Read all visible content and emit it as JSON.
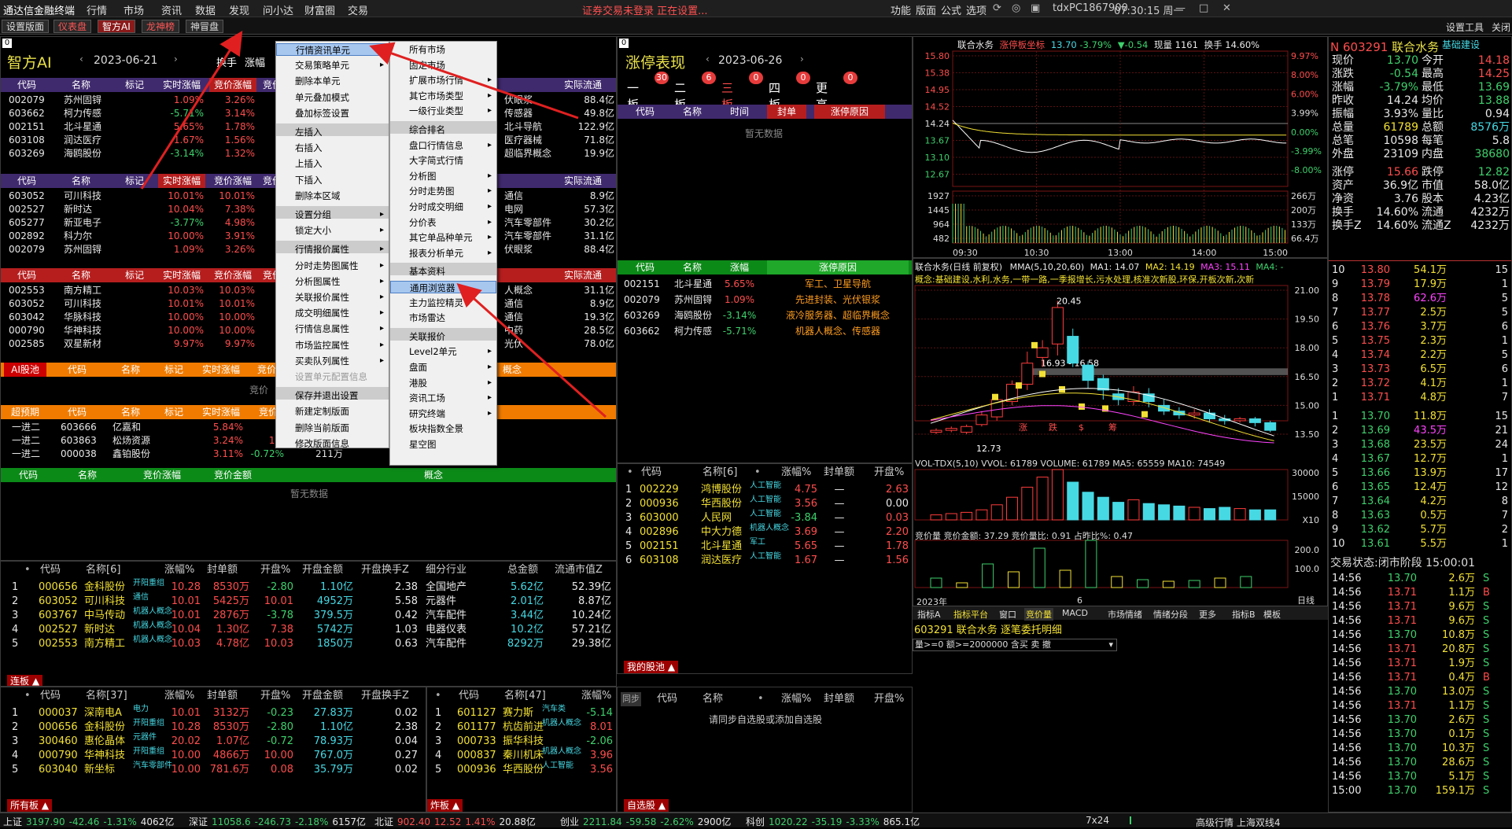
{
  "menubar": {
    "app": "通达信金融终端",
    "items": [
      "行情",
      "市场",
      "资讯",
      "数据",
      "发现",
      "问小达",
      "财富圈",
      "交易"
    ],
    "status": "证券交易未登录 正在设置...",
    "right": [
      "功能",
      "版面",
      "公式",
      "选项"
    ],
    "user": "tdxPC1867900",
    "time": "07:30:15 周一"
  },
  "tabs": [
    "设置版面",
    "仪表盘",
    "智方AI",
    "龙神榜",
    "神冒盘"
  ],
  "tabs_right": [
    "设置工具",
    "关闭"
  ],
  "zhifang": {
    "title": "智方AI",
    "date": "2023-06-21",
    "huanshou": "换手",
    "zhangfu": "涨幅"
  },
  "grp1": {
    "headers": [
      "代码",
      "名称",
      "标记",
      "实时涨幅",
      "竞价涨幅",
      "竞价",
      "实际流通"
    ],
    "rows": [
      [
        "002079",
        "苏州固锝",
        "",
        "1.09%",
        "3.26%",
        "",
        "88.4亿"
      ],
      [
        "603662",
        "柯力传感",
        "",
        "-5.71%",
        "3.14%",
        "",
        "49.8亿"
      ],
      [
        "002151",
        "北斗星通",
        "",
        "5.65%",
        "1.78%",
        "",
        "122.9亿"
      ],
      [
        "603108",
        "润达医疗",
        "",
        "1.67%",
        "1.56%",
        "",
        "71.8亿"
      ],
      [
        "603269",
        "海鸥股份",
        "",
        "-3.14%",
        "1.32%",
        "",
        "19.9亿"
      ]
    ]
  },
  "grp2": {
    "rows": [
      [
        "603052",
        "可川科技",
        "",
        "10.01%",
        "10.01%",
        "",
        "8.9亿"
      ],
      [
        "002527",
        "新时达",
        "",
        "10.04%",
        "7.38%",
        "",
        "57.3亿"
      ],
      [
        "605277",
        "新亚电子",
        "",
        "-3.77%",
        "4.98%",
        "",
        "30.2亿"
      ],
      [
        "002892",
        "科力尔",
        "",
        "10.00%",
        "3.91%",
        "",
        "31.1亿"
      ],
      [
        "002079",
        "苏州固锝",
        "",
        "1.09%",
        "3.26%",
        "",
        "88.4亿"
      ]
    ]
  },
  "grp3": {
    "rows": [
      [
        "002553",
        "南方精工",
        "",
        "10.03%",
        "10.03%",
        "",
        "31.1亿"
      ],
      [
        "603052",
        "可川科技",
        "",
        "10.01%",
        "10.01%",
        "",
        "8.9亿"
      ],
      [
        "603042",
        "华脉科技",
        "",
        "10.00%",
        "10.00%",
        "",
        "19.3亿"
      ],
      [
        "000790",
        "华神科技",
        "",
        "10.00%",
        "10.00%",
        "",
        "28.5亿"
      ],
      [
        "002585",
        "双星新材",
        "",
        "9.97%",
        "9.97%",
        "",
        "78.0亿"
      ]
    ]
  },
  "grp_concept_texts": [
    "伏眼浆",
    "传感器",
    "北斗导航",
    "医疗器械",
    "超临界概念",
    "通信",
    "电网",
    "汽车零部件",
    "汽车零部件",
    "伏眼浆",
    "人概念",
    "通信",
    "通信",
    "中药",
    "光伏"
  ],
  "ai_bar": {
    "headers": [
      "AI股池",
      "代码",
      "名称",
      "标记",
      "实时涨幅",
      "竞价涨幅",
      "竞价",
      "概念"
    ],
    "empty": "竞价"
  },
  "chaoyuqi": {
    "headers": [
      "超预期",
      "代码",
      "名称",
      "标记",
      "实时涨幅",
      "竞价"
    ],
    "rows": [
      [
        "一进二",
        "603666",
        "亿嘉和",
        "",
        "5.84%",
        ""
      ],
      [
        "一进二",
        "603863",
        "松炀资源",
        "",
        "3.24%",
        "1.6"
      ],
      [
        "一进二",
        "000038",
        "鑫铂股份",
        "",
        "3.11%",
        "-0.72%",
        "211万"
      ]
    ]
  },
  "green_bar": {
    "headers": [
      "代码",
      "名称",
      "竞价涨幅",
      "竞价金额",
      "概念"
    ],
    "empty": "暂无数据"
  },
  "ctx1": {
    "items": [
      "行情资讯单元",
      "交易策略单元",
      "删除本单元",
      "单元叠加模式",
      "叠加标签设置",
      "左插入",
      "右插入",
      "上插入",
      "下插入",
      "删除本区域",
      "设置分组",
      "锁定大小",
      "行情报价属性",
      "分时走势图属性",
      "分析图属性",
      "关联报价属性",
      "成交明细属性",
      "行情信息属性",
      "市场监控属性",
      "买卖队列属性",
      "设置单元配置信息",
      "保存并退出设置",
      "新建定制版面",
      "删除当前版面",
      "修改版面信息"
    ]
  },
  "ctx2": {
    "items": [
      "所有市场",
      "固定市场",
      "扩展市场行情",
      "其它市场类型",
      "一级行业类型",
      "综合排名",
      "盘口行情信息",
      "大字简式行情",
      "分析图",
      "分时走势图",
      "分时成交明细",
      "分价表",
      "其它单品种单元",
      "报表分析单元",
      "基本资料",
      "通用浏览器",
      "主力监控精灵",
      "市场雷达",
      "关联报价",
      "Level2单元",
      "盘面",
      "港股",
      "资讯工场",
      "研究终端",
      "板块指数全景",
      "星空图"
    ]
  },
  "zt": {
    "title": "涨停表现",
    "date": "2023-06-26",
    "boards": [
      {
        "l": "一板",
        "n": "30"
      },
      {
        "l": "二板",
        "n": "6"
      },
      {
        "l": "三板",
        "n": "0"
      },
      {
        "l": "四板",
        "n": "0"
      },
      {
        "l": "更高",
        "n": "0"
      }
    ],
    "headers": [
      "代码",
      "名称",
      "时间",
      "封单",
      "涨停原因"
    ],
    "empty": "暂无数据"
  },
  "zt2": {
    "headers": [
      "代码",
      "名称",
      "涨幅",
      "涨停原因"
    ],
    "rows": [
      [
        "002151",
        "北斗星通",
        "5.65%",
        "军工、卫星导航"
      ],
      [
        "002079",
        "苏州固锝",
        "1.09%",
        "先进封装、光伏银浆"
      ],
      [
        "603269",
        "海鸥股份",
        "-3.14%",
        "液冷服务器、超临界概念"
      ],
      [
        "603662",
        "柯力传感",
        "-5.71%",
        "机器人概念、传感器"
      ]
    ]
  },
  "mid_list": {
    "headers": [
      "代码",
      "名称[6]",
      "涨幅%",
      "封单额",
      "开盘%"
    ],
    "rows": [
      [
        "1",
        "002229",
        "鸿博股份",
        "人工智能",
        "4.75",
        "—",
        "2.63"
      ],
      [
        "2",
        "000936",
        "华西股份",
        "人工智能",
        "3.56",
        "—",
        "0.00"
      ],
      [
        "3",
        "603000",
        "人民网",
        "人工智能",
        "-3.84",
        "—",
        "0.03"
      ],
      [
        "4",
        "002896",
        "中大力德",
        "机器人概念",
        "3.69",
        "—",
        "2.20"
      ],
      [
        "5",
        "002151",
        "北斗星通",
        "军工",
        "5.65",
        "—",
        "1.78"
      ],
      [
        "6",
        "603108",
        "润达医疗",
        "人工智能",
        "1.67",
        "—",
        "1.56"
      ]
    ]
  },
  "zixuan": {
    "tab": "我的股池",
    "headers": [
      "同步",
      "代码",
      "名称",
      "涨幅%",
      "封单额",
      "开盘%"
    ],
    "empty": "请同步自选股或添加自选股",
    "bottom": "自选股"
  },
  "lb1": {
    "headers": [
      "代码",
      "名称[6]",
      "涨幅%",
      "封单额",
      "开盘%",
      "开盘金额",
      "开盘换手Z",
      "细分行业",
      "总金额",
      "流通市值Z"
    ],
    "rows": [
      [
        "1",
        "000656",
        "金科股份",
        "开阳重组",
        "10.28",
        "8530万",
        "-2.80",
        "1.10亿",
        "2.38",
        "全国地产",
        "5.62亿",
        "52.39亿"
      ],
      [
        "2",
        "603052",
        "可川科技",
        "通信",
        "10.01",
        "5425万",
        "10.01",
        "4952万",
        "5.58",
        "元器件",
        "2.01亿",
        "8.87亿"
      ],
      [
        "3",
        "603767",
        "中马传动",
        "机器人概念",
        "10.01",
        "2876万",
        "-3.78",
        "379.5万",
        "0.42",
        "汽车配件",
        "3.44亿",
        "10.24亿"
      ],
      [
        "4",
        "002527",
        "新时达",
        "机器人概念",
        "10.04",
        "1.30亿",
        "7.38",
        "5742万",
        "1.03",
        "电器仪表",
        "10.2亿",
        "57.21亿"
      ],
      [
        "5",
        "002553",
        "南方精工",
        "机器人概念",
        "10.03",
        "4.78亿",
        "10.03",
        "1850万",
        "0.63",
        "汽车配件",
        "8292万",
        "29.38亿"
      ]
    ],
    "tab": "连板"
  },
  "lb2": {
    "headers": [
      "代码",
      "名称[37]",
      "涨幅%",
      "封单额",
      "开盘%",
      "开盘金额",
      "开盘换手Z"
    ],
    "rows": [
      [
        "1",
        "000037",
        "深南电A",
        "电力",
        "10.01",
        "3132万",
        "-0.23",
        "27.83万",
        "0.02"
      ],
      [
        "2",
        "000656",
        "金科股份",
        "开阳重组",
        "10.28",
        "8530万",
        "-2.80",
        "1.10亿",
        "2.38"
      ],
      [
        "3",
        "300460",
        "惠伦晶体",
        "元器件",
        "20.02",
        "1.07亿",
        "-0.72",
        "78.93万",
        "0.04"
      ],
      [
        "4",
        "000790",
        "华神科技",
        "开阳重组",
        "10.00",
        "4866万",
        "10.00",
        "767.0万",
        "0.27"
      ],
      [
        "5",
        "603040",
        "新坐标",
        "汽车零部件",
        "10.00",
        "781.6万",
        "0.08",
        "35.79万",
        "0.02"
      ]
    ],
    "tab": "所有板"
  },
  "lb3": {
    "headers": [
      "代码",
      "名称[47]",
      "涨幅%"
    ],
    "rows": [
      [
        "1",
        "601127",
        "赛力斯",
        "汽车类",
        "-5.14"
      ],
      [
        "2",
        "601177",
        "杭齿前进",
        "机器人概念",
        "8.01"
      ],
      [
        "3",
        "000733",
        "振华科技",
        "",
        "-2.06"
      ],
      [
        "4",
        "000837",
        "秦川机床",
        "机器人概念",
        "3.96"
      ],
      [
        "5",
        "000936",
        "华西股份",
        "人工智能",
        "3.56"
      ]
    ],
    "tab": "炸板"
  },
  "intraday": {
    "name": "联合水务",
    "mark": "涨停板坐标",
    "price": "13.70",
    "pct": "-3.79%",
    "chg": "▼-0.54",
    "vol": "现量 1161",
    "hs": "换手 14.60%",
    "y": [
      "15.80",
      "15.38",
      "14.95",
      "14.52",
      "14.24",
      "13.67",
      "13.10",
      "12.67"
    ],
    "yr": [
      "9.97%",
      "8.00%",
      "6.00%",
      "3.99%",
      "0.00%",
      "-3.99%",
      "-8.00%"
    ],
    "vy": [
      "1927",
      "1445",
      "964",
      "482"
    ],
    "vyr": [
      "266万",
      "200万",
      "133万",
      "66.4万"
    ],
    "x": [
      "09:30",
      "10:30",
      "13:00",
      "14:00",
      "15:00"
    ]
  },
  "kline": {
    "title": "联合水务(日线 前复权)",
    "ma": "MMA(5,10,20,60)",
    "ma1": "MA1: 14.07",
    "ma2": "MA2: 14.19",
    "ma3": "MA3: 15.11",
    "ma4": "MA4: -",
    "concept": "概念:基础建设,水利,水务,一带一路,一季报增长,污水处理,核准次新股,环保,开板次新,次新",
    "y": [
      "21.00",
      "19.50",
      "18.00",
      "16.50",
      "15.00",
      "13.50"
    ],
    "hi": "20.45",
    "band": "16.93 - 16.58",
    "lo": "12.73",
    "labels": [
      "涨",
      "跌",
      "$",
      "筹"
    ],
    "vol": "VOL-TDX(5,10) VVOL: 61789 VOLUME: 61789 MA5: 65559 MA10: 74549",
    "vy": [
      "30000",
      "15000",
      "X10"
    ],
    "jj": "竞价量 竞价金额: 37.29 竞价量比: 0.91 占昨比%: 0.47",
    "jy": [
      "200.0",
      "100.0"
    ],
    "year": "2023年",
    "month": "6",
    "tabs": [
      "指标A",
      "指标平台",
      "窗口",
      "竞价量",
      "MACD",
      "市场情绪",
      "情绪分段",
      "更多"
    ],
    "tabsR": [
      "指标B",
      "模板"
    ],
    "wt_title": "603291 联合水务 逐笔委托明细",
    "wt_filter": "量>=0 额>=2000000 含买 卖 撤"
  },
  "quote": {
    "code": "603291",
    "name": "联合水务",
    "tag": "基础建设",
    "rows": [
      [
        "现价",
        "13.70",
        "今开",
        "14.18"
      ],
      [
        "涨跌",
        "-0.54",
        "最高",
        "14.25"
      ],
      [
        "涨幅",
        "-3.79%",
        "最低",
        "13.69"
      ],
      [
        "昨收",
        "14.24",
        "均价",
        "13.88"
      ],
      [
        "振幅",
        "3.93%",
        "量比",
        "0.94"
      ],
      [
        "总量",
        "61789",
        "总额",
        "8576万"
      ],
      [
        "总笔",
        "10598",
        "每笔",
        "5.8"
      ],
      [
        "外盘",
        "23109",
        "内盘",
        "38680"
      ]
    ],
    "rows2": [
      [
        "涨停",
        "15.66",
        "跌停",
        "12.82"
      ],
      [
        "资产",
        "36.9亿",
        "市值",
        "58.0亿"
      ],
      [
        "净资",
        "3.76",
        "股本",
        "4.23亿"
      ],
      [
        "换手",
        "14.60%",
        "流通",
        "4232万"
      ],
      [
        "换手Z",
        "14.60%",
        "流通Z",
        "4232万"
      ]
    ],
    "sell": [
      [
        "10",
        "13.80",
        "54.1万",
        "15"
      ],
      [
        "9",
        "13.79",
        "17.9万",
        "1"
      ],
      [
        "8",
        "13.78",
        "62.6万",
        "5"
      ],
      [
        "7",
        "13.77",
        "2.5万",
        "5"
      ],
      [
        "6",
        "13.76",
        "3.7万",
        "6"
      ],
      [
        "5",
        "13.75",
        "2.3万",
        "1"
      ],
      [
        "4",
        "13.74",
        "2.2万",
        "5"
      ],
      [
        "3",
        "13.73",
        "6.5万",
        "6"
      ],
      [
        "2",
        "13.72",
        "4.1万",
        "1"
      ],
      [
        "1",
        "13.71",
        "4.8万",
        "7"
      ]
    ],
    "buy": [
      [
        "1",
        "13.70",
        "11.8万",
        "15"
      ],
      [
        "2",
        "13.69",
        "43.5万",
        "21"
      ],
      [
        "3",
        "13.68",
        "23.5万",
        "24"
      ],
      [
        "4",
        "13.67",
        "12.7万",
        "1"
      ],
      [
        "5",
        "13.66",
        "13.9万",
        "17"
      ],
      [
        "6",
        "13.65",
        "12.4万",
        "12"
      ],
      [
        "7",
        "13.64",
        "4.2万",
        "8"
      ],
      [
        "8",
        "13.63",
        "0.5万",
        "7"
      ],
      [
        "9",
        "13.62",
        "5.7万",
        "2"
      ],
      [
        "10",
        "13.61",
        "5.5万",
        "1"
      ]
    ],
    "status": "交易状态:闭市阶段 15:00:01",
    "ticks": [
      [
        "14:56",
        "13.70",
        "2.6万",
        "S"
      ],
      [
        "14:56",
        "13.71",
        "1.1万",
        "B"
      ],
      [
        "14:56",
        "13.71",
        "9.6万",
        "S"
      ],
      [
        "14:56",
        "13.71",
        "9.6万",
        "S"
      ],
      [
        "14:56",
        "13.70",
        "10.8万",
        "S"
      ],
      [
        "14:56",
        "13.71",
        "20.8万",
        "S"
      ],
      [
        "14:56",
        "13.71",
        "1.9万",
        "S"
      ],
      [
        "14:56",
        "13.71",
        "0.4万",
        "B"
      ],
      [
        "14:56",
        "13.70",
        "13.0万",
        "S"
      ],
      [
        "14:56",
        "13.71",
        "1.1万",
        "S"
      ],
      [
        "14:56",
        "13.70",
        "2.6万",
        "S"
      ],
      [
        "14:56",
        "13.70",
        "0.1万",
        "S"
      ],
      [
        "14:56",
        "13.70",
        "10.3万",
        "S"
      ],
      [
        "14:56",
        "13.70",
        "28.6万",
        "S"
      ],
      [
        "14:56",
        "13.70",
        "5.1万",
        "S"
      ],
      [
        "15:00",
        "13.70",
        "159.1万",
        "S"
      ]
    ]
  },
  "statusbar": {
    "items": [
      [
        "上证",
        "3197.90",
        "-42.46",
        "-1.31%",
        "4062亿"
      ],
      [
        "深证",
        "11058.6",
        "-246.73",
        "-2.18%",
        "6157亿"
      ],
      [
        "北证",
        "902.40",
        "12.52",
        "1.41%",
        "20.88亿"
      ],
      [
        "创业",
        "2211.84",
        "-59.58",
        "-2.62%",
        "2900亿"
      ],
      [
        "科创",
        "1020.22",
        "-35.19",
        "-3.33%",
        "865.1亿"
      ]
    ],
    "right": "高级行情 上海双线4",
    "x24": "7x24"
  }
}
